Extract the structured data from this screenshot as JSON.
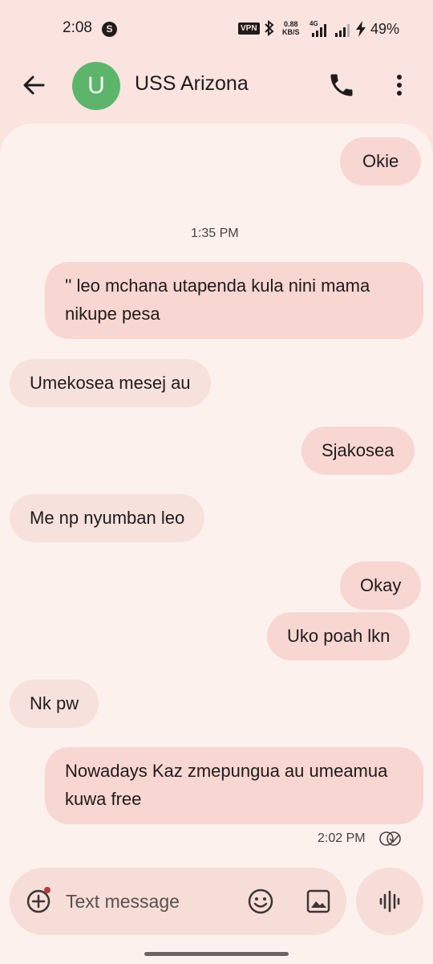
{
  "status_bar": {
    "time": "2:08",
    "vpn": "VPN",
    "speed_value": "0.88",
    "speed_unit": "KB/S",
    "network": "4G",
    "battery": "49%"
  },
  "header": {
    "avatar_letter": "U",
    "contact_name": "USS Arizona"
  },
  "messages": [
    {
      "direction": "out",
      "text": "Okie"
    },
    {
      "type": "timestamp",
      "text": "1:35 PM"
    },
    {
      "direction": "out",
      "text": "'' leo mchana utapenda kula nini mama nikupe pesa"
    },
    {
      "direction": "in",
      "text": "Umekosea mesej au"
    },
    {
      "direction": "out",
      "text": "Sjakosea"
    },
    {
      "direction": "in",
      "text": "Me np nyumban leo"
    },
    {
      "direction": "out",
      "text": "Okay"
    },
    {
      "direction": "out",
      "text": "Uko poah lkn"
    },
    {
      "direction": "in",
      "text": "Nk pw"
    },
    {
      "direction": "out",
      "text": "Nowadays Kaz zmepungua au umeamua kuwa free"
    }
  ],
  "last_message_time": "2:02 PM",
  "composer": {
    "placeholder": "Text message"
  },
  "colors": {
    "background": "#fbe3df",
    "chat_panel": "#fdf1ee",
    "outgoing_bubble": "#f8d6d1",
    "incoming_bubble": "#f7e1dc",
    "avatar": "#5cb56b"
  }
}
